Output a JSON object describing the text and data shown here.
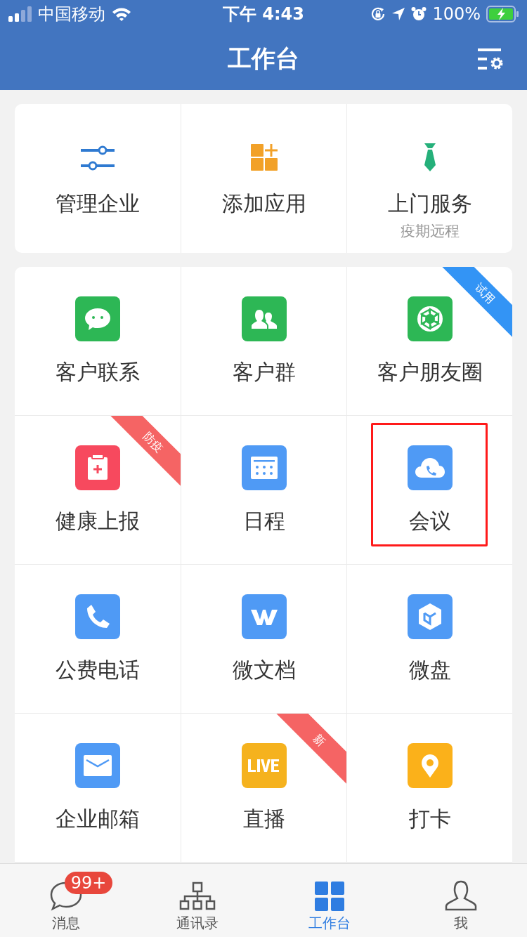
{
  "status_bar": {
    "carrier": "中国移动",
    "time": "下午 4:43",
    "battery": "100%"
  },
  "nav_bar": {
    "title": "工作台"
  },
  "quick_actions": [
    {
      "label": "管理企业"
    },
    {
      "label": "添加应用"
    },
    {
      "label": "上门服务",
      "subtitle": "疫期远程"
    }
  ],
  "apps": [
    {
      "label": "客户联系",
      "highlighted": false
    },
    {
      "label": "客户群",
      "highlighted": false
    },
    {
      "label": "客户朋友圈",
      "highlighted": false,
      "ribbon": {
        "text": "试用",
        "color": "#3394f5"
      }
    },
    {
      "label": "健康上报",
      "highlighted": false,
      "ribbon": {
        "text": "防疫",
        "color": "#f56464"
      }
    },
    {
      "label": "日程",
      "highlighted": false
    },
    {
      "label": "会议",
      "highlighted": true
    },
    {
      "label": "公费电话",
      "highlighted": false
    },
    {
      "label": "微文档",
      "highlighted": false
    },
    {
      "label": "微盘",
      "highlighted": false
    },
    {
      "label": "企业邮箱",
      "highlighted": false
    },
    {
      "label": "直播",
      "highlighted": false,
      "ribbon": {
        "text": "新",
        "color": "#f56464"
      }
    },
    {
      "label": "打卡",
      "highlighted": false
    }
  ],
  "tab_bar": [
    {
      "label": "消息",
      "selected": false,
      "badge": "99+"
    },
    {
      "label": "通讯录",
      "selected": false
    },
    {
      "label": "工作台",
      "selected": true
    },
    {
      "label": "我",
      "selected": false
    }
  ]
}
